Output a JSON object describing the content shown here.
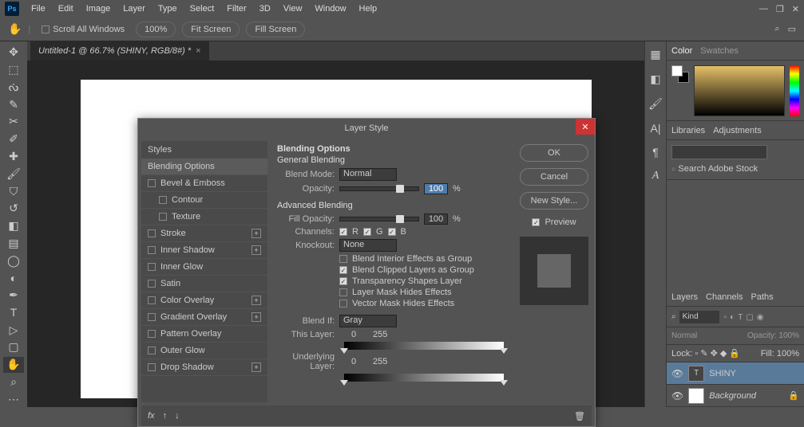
{
  "menubar": {
    "items": [
      "File",
      "Edit",
      "Image",
      "Layer",
      "Type",
      "Select",
      "Filter",
      "3D",
      "View",
      "Window",
      "Help"
    ]
  },
  "optionsbar": {
    "scroll_all": "Scroll All Windows",
    "zoom": "100%",
    "fit": "Fit Screen",
    "fill": "Fill Screen"
  },
  "document": {
    "tab": "Untitled-1 @ 66.7% (SHINY, RGB/8#) *"
  },
  "right": {
    "color_tab": "Color",
    "swatches_tab": "Swatches",
    "libraries_tab": "Libraries",
    "adjustments_tab": "Adjustments",
    "search_placeholder": "Search Adobe Stock",
    "layers_tab": "Layers",
    "channels_tab": "Channels",
    "paths_tab": "Paths",
    "kind": "Kind",
    "mode": "Normal",
    "opacity_label": "Opacity:",
    "opacity_val": "100%",
    "lock": "Lock:",
    "fill_label": "Fill:",
    "fill_val": "100%",
    "layers": [
      {
        "name": "SHINY",
        "type": "text",
        "selected": true
      },
      {
        "name": "Background",
        "type": "bg",
        "locked": true
      }
    ]
  },
  "dialog": {
    "title": "Layer Style",
    "buttons": {
      "ok": "OK",
      "cancel": "Cancel",
      "new_style": "New Style...",
      "preview": "Preview"
    },
    "styles_header": "Styles",
    "styles": [
      {
        "label": "Blending Options",
        "selected": true,
        "check": false,
        "plus": false
      },
      {
        "label": "Bevel & Emboss",
        "check": true,
        "plus": false
      },
      {
        "label": "Contour",
        "check": true,
        "indent": true
      },
      {
        "label": "Texture",
        "check": true,
        "indent": true
      },
      {
        "label": "Stroke",
        "check": true,
        "plus": true
      },
      {
        "label": "Inner Shadow",
        "check": true,
        "plus": true
      },
      {
        "label": "Inner Glow",
        "check": true
      },
      {
        "label": "Satin",
        "check": true
      },
      {
        "label": "Color Overlay",
        "check": true,
        "plus": true
      },
      {
        "label": "Gradient Overlay",
        "check": true,
        "plus": true
      },
      {
        "label": "Pattern Overlay",
        "check": true
      },
      {
        "label": "Outer Glow",
        "check": true
      },
      {
        "label": "Drop Shadow",
        "check": true,
        "plus": true
      }
    ],
    "opts": {
      "section": "Blending Options",
      "general": "General Blending",
      "blend_mode_label": "Blend Mode:",
      "blend_mode": "Normal",
      "opacity_label": "Opacity:",
      "opacity": "100",
      "pct": "%",
      "advanced": "Advanced Blending",
      "fill_opacity_label": "Fill Opacity:",
      "fill_opacity": "100",
      "channels_label": "Channels:",
      "ch_r": "R",
      "ch_g": "G",
      "ch_b": "B",
      "knockout_label": "Knockout:",
      "knockout": "None",
      "c1": "Blend Interior Effects as Group",
      "c2": "Blend Clipped Layers as Group",
      "c3": "Transparency Shapes Layer",
      "c4": "Layer Mask Hides Effects",
      "c5": "Vector Mask Hides Effects",
      "blend_if_label": "Blend If:",
      "blend_if": "Gray",
      "this_layer": "This Layer:",
      "v0": "0",
      "v255": "255",
      "underlying": "Underlying Layer:"
    }
  }
}
